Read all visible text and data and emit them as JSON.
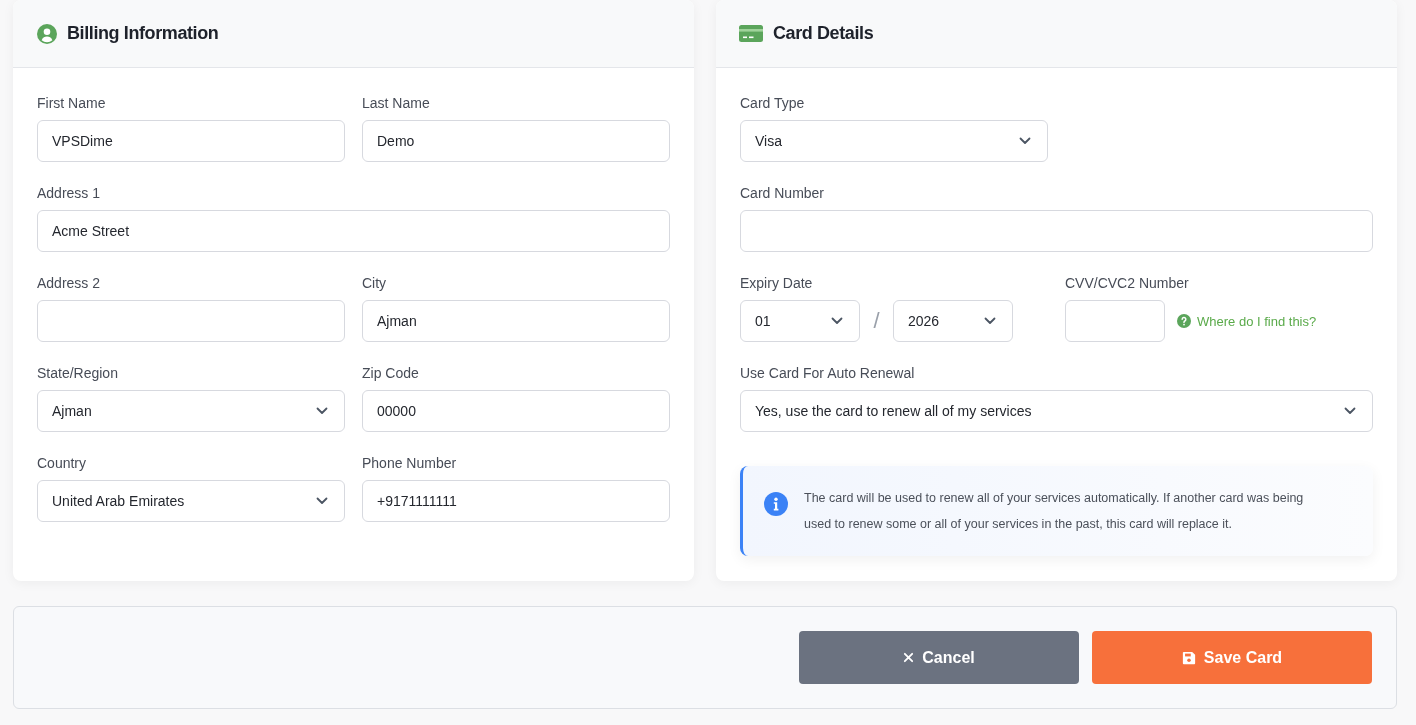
{
  "billing": {
    "title": "Billing Information",
    "rows": [
      [
        {
          "label": "First Name",
          "kind": "text",
          "value": "VPSDime"
        },
        {
          "label": "Last Name",
          "kind": "text",
          "value": "Demo"
        }
      ],
      [
        {
          "label": "Address 1",
          "kind": "text",
          "value": "Acme Street"
        }
      ],
      [
        {
          "label": "Address 2",
          "kind": "text"
        },
        {
          "label": "City",
          "kind": "text",
          "value": "Ajman"
        }
      ],
      [
        {
          "label": "State/Region",
          "kind": "select",
          "value": "Ajman"
        },
        {
          "label": "Zip Code",
          "kind": "text",
          "value": "00000"
        }
      ],
      [
        {
          "label": "Country",
          "kind": "select",
          "value": "United Arab Emirates"
        },
        {
          "label": "Phone Number",
          "kind": "text",
          "value": "+9171111111"
        }
      ]
    ]
  },
  "card_details": {
    "title": "Card Details",
    "card_type": {
      "label": "Card Type",
      "kind": "select",
      "value": "Visa"
    },
    "card_number": {
      "label": "Card Number",
      "kind": "text"
    },
    "expiry": {
      "label": "Expiry Date",
      "month": "01",
      "separator": "/",
      "year": "2026"
    },
    "cvv": {
      "label": "CVV/CVC2 Number",
      "help_link": "Where do I find this?"
    },
    "auto_renewal": {
      "label": "Use Card For Auto Renewal",
      "kind": "select",
      "value": "Yes, use the card to renew all of my services"
    },
    "notice": "The card will be used to renew all of your services automatically. If another card was being used to renew some or all of your services in the past, this card will replace it."
  },
  "actions": [
    {
      "label": "Cancel",
      "kind": "cancel"
    },
    {
      "label": "Save Card",
      "kind": "save"
    }
  ]
}
